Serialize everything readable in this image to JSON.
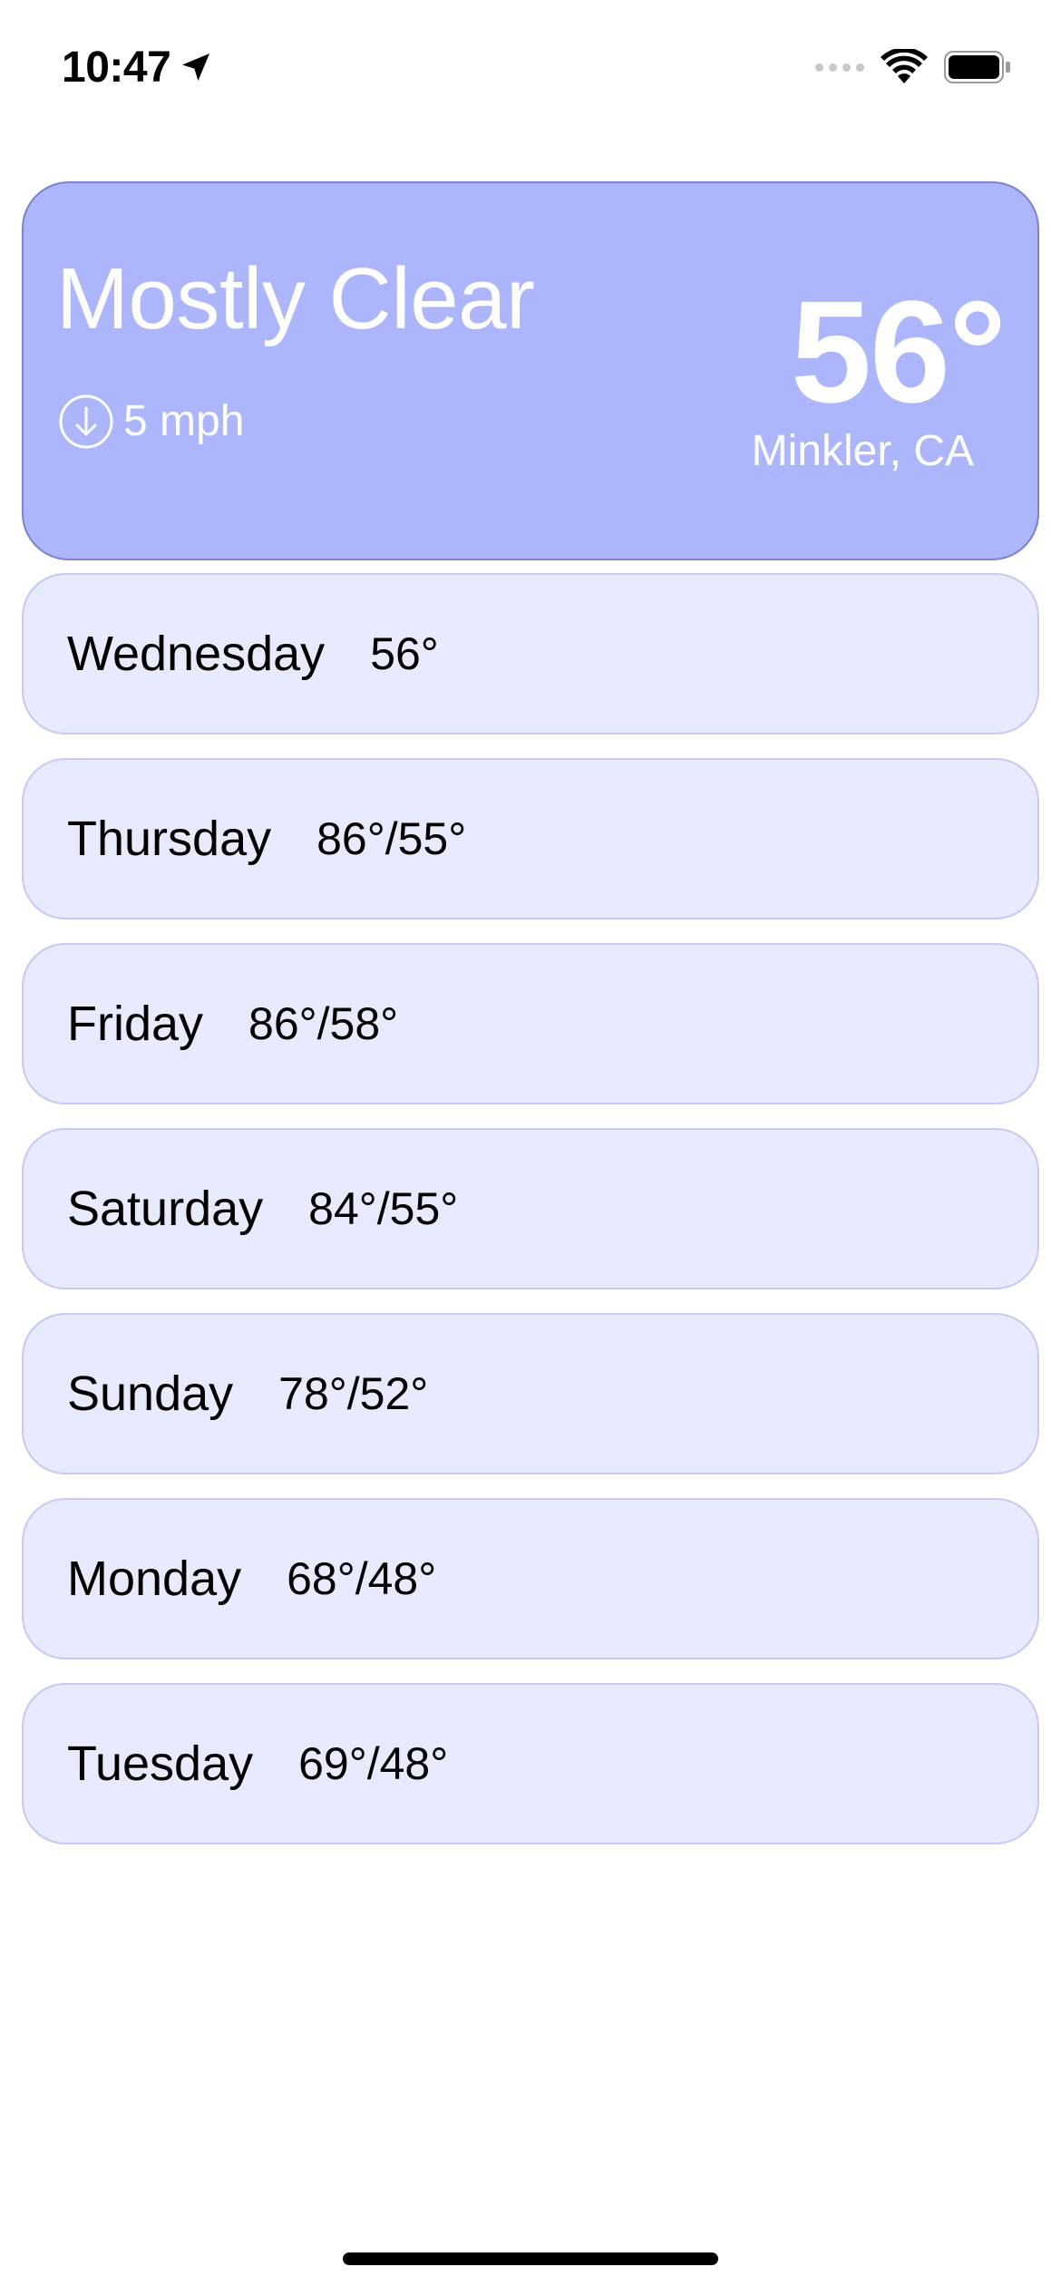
{
  "status_bar": {
    "time": "10:47"
  },
  "current": {
    "condition": "Mostly Clear",
    "wind": "5 mph",
    "temperature": "56°",
    "location": "Minkler, CA"
  },
  "forecast": [
    {
      "day": "Wednesday",
      "temp": "56°"
    },
    {
      "day": "Thursday",
      "temp": "86°/55°"
    },
    {
      "day": "Friday",
      "temp": "86°/58°"
    },
    {
      "day": "Saturday",
      "temp": "84°/55°"
    },
    {
      "day": "Sunday",
      "temp": "78°/52°"
    },
    {
      "day": "Monday",
      "temp": "68°/48°"
    },
    {
      "day": "Tuesday",
      "temp": "69°/48°"
    }
  ],
  "colors": {
    "card_background": "#adb6fd",
    "card_border": "#7b81cc",
    "row_background": "#e8eafd",
    "row_border": "#c6c9f3"
  },
  "icons": {
    "location": "location-arrow-icon",
    "signal": "cellular-signal-icon",
    "wifi": "wifi-icon",
    "battery": "battery-icon",
    "wind": "wind-direction-icon"
  }
}
